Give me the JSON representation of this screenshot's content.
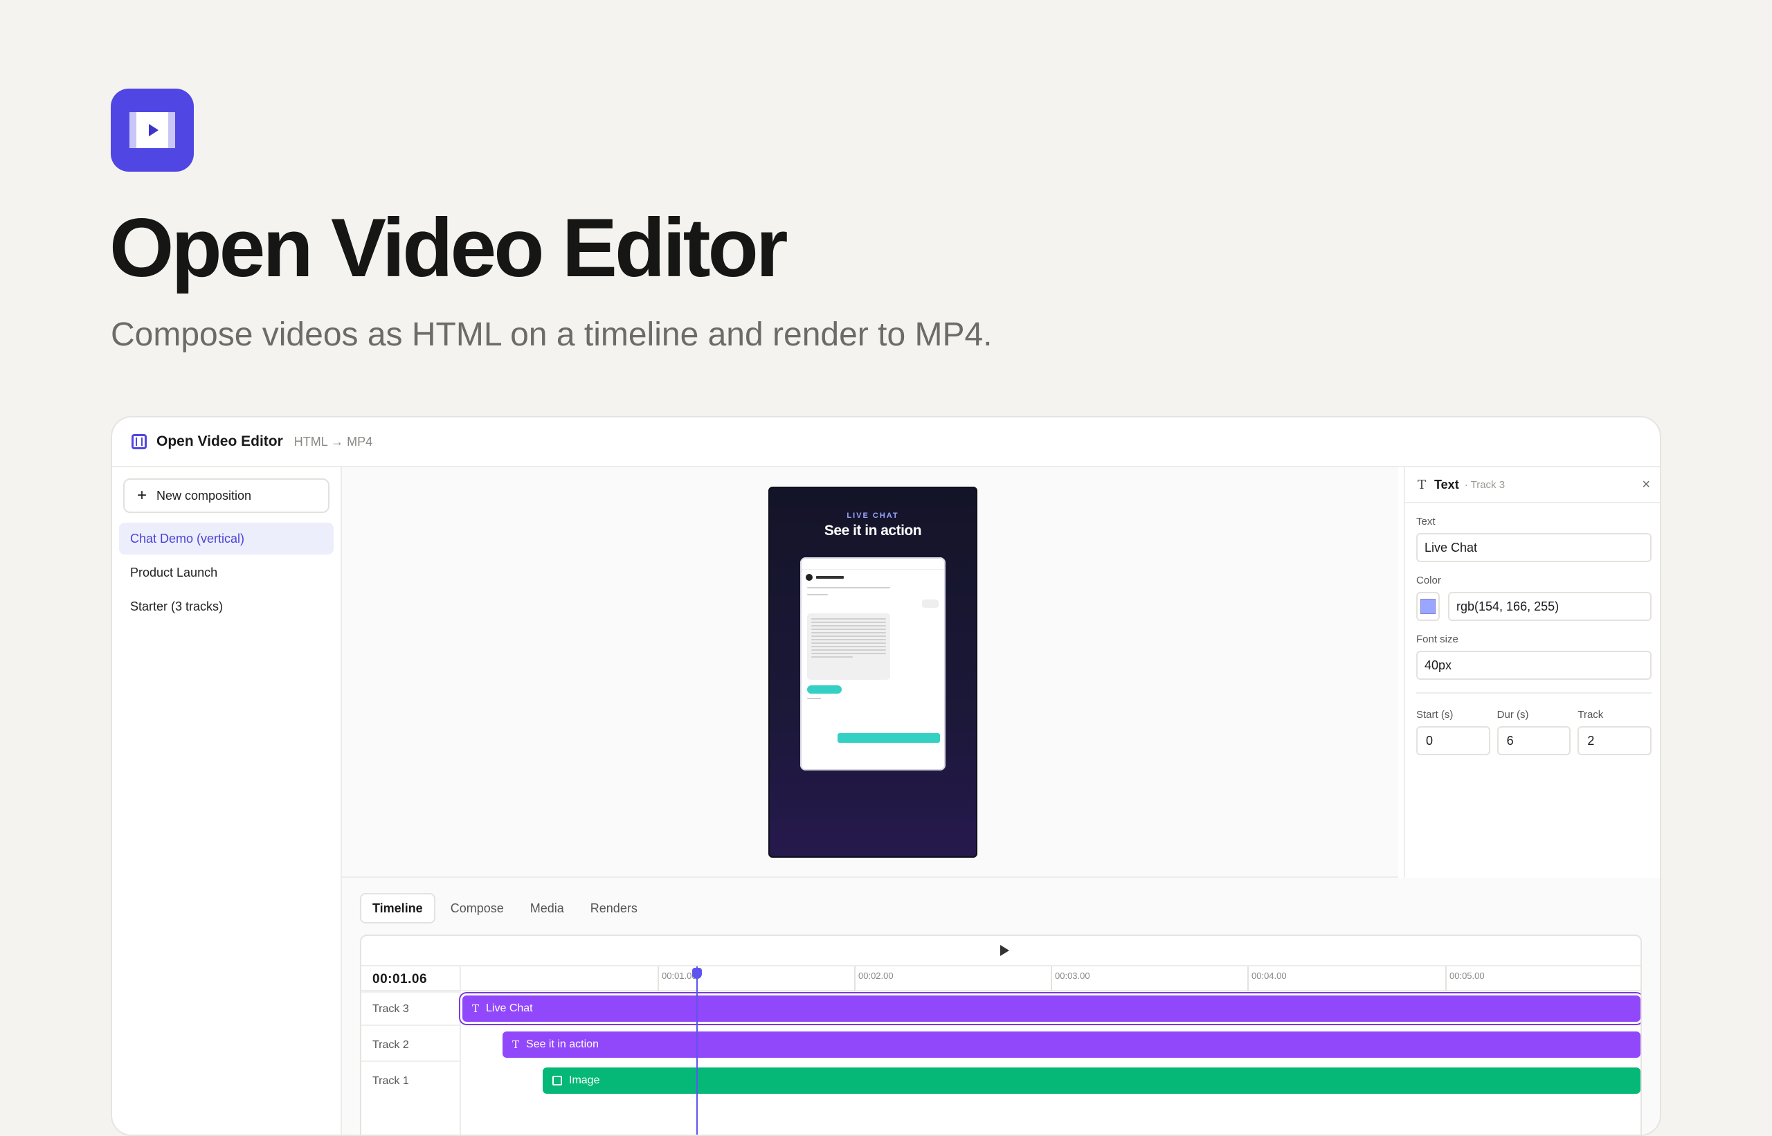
{
  "hero": {
    "title": "Open Video Editor",
    "subtitle": "Compose videos as HTML on a timeline and render to MP4.",
    "logo_icon": "film-play-icon",
    "accent": "#5046e4"
  },
  "app": {
    "name": "Open Video Editor",
    "tagline": "HTML → MP4"
  },
  "sidebar": {
    "new_label": "New composition",
    "items": [
      {
        "label": "Chat Demo (vertical)",
        "active": true
      },
      {
        "label": "Product Launch",
        "active": false
      },
      {
        "label": "Starter (3 tracks)",
        "active": false
      }
    ]
  },
  "preview": {
    "eyebrow": "LIVE CHAT",
    "headline": "See it in action"
  },
  "inspector": {
    "type": "Text",
    "track": "· Track 3",
    "text_label": "Text",
    "text_value": "Live Chat",
    "color_label": "Color",
    "color_value": "rgb(154, 166, 255)",
    "font_size_label": "Font size",
    "font_size_value": "40px",
    "start_label": "Start (s)",
    "start_value": "0",
    "dur_label": "Dur (s)",
    "dur_value": "6",
    "track_label": "Track",
    "track_value": "2"
  },
  "tabs": [
    "Timeline",
    "Compose",
    "Media",
    "Renders"
  ],
  "timeline": {
    "timecode": "00:01.06",
    "ticks": [
      "00:01.00",
      "00:02.00",
      "00:03.00",
      "00:04.00",
      "00:05.00"
    ],
    "tracks": [
      {
        "label": "Track 3",
        "clip": "Live Chat",
        "kind": "text",
        "color": "#9148fa"
      },
      {
        "label": "Track 2",
        "clip": "See it in action",
        "kind": "text",
        "color": "#9148fa"
      },
      {
        "label": "Track 1",
        "clip": "Image",
        "kind": "image",
        "color": "#05b878"
      }
    ]
  }
}
